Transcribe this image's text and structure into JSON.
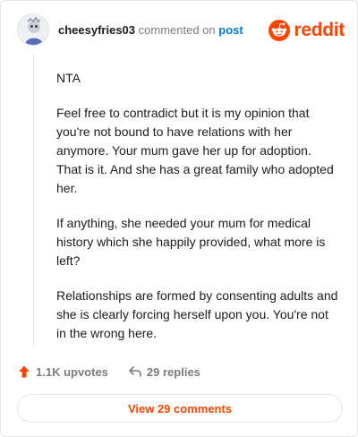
{
  "comment": {
    "username": "cheesyfries03",
    "action": "commented on",
    "post_link": "post",
    "paragraphs": [
      "NTA",
      "Feel free to contradict but it is my opinion that you're not bound to have relations with her anymore. Your mum gave her up for adoption. That is it. And she has a great family who adopted her.",
      "If anything, she needed your mum for medical history which she happily provided, what more is left?",
      "Relationships are formed by consenting adults and she is clearly forcing herself upon you. You're not in the wrong here."
    ]
  },
  "brand": {
    "wordmark": "reddit",
    "icon": "reddit-snoo-icon"
  },
  "stats": {
    "upvotes": "1.1K upvotes",
    "upvote_icon": "upvote-arrow-icon",
    "replies": "29 replies",
    "reply_icon": "reply-arrow-icon"
  },
  "view_button": {
    "label": "View 29 comments"
  },
  "colors": {
    "accent": "#ff4500",
    "link": "#0079d3",
    "muted": "#7c7c7c",
    "text": "#1c1c1c"
  }
}
